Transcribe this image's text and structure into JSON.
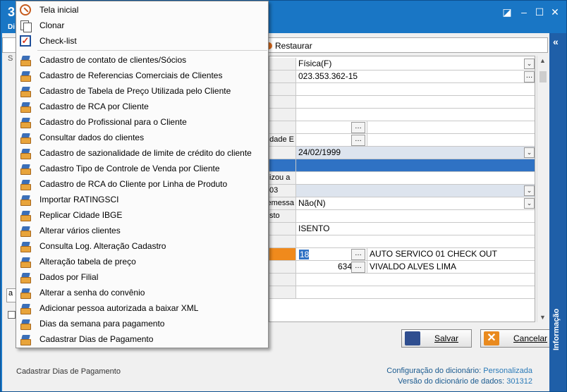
{
  "window": {
    "title_number": "3",
    "title_sub": "Di"
  },
  "toolbar": {
    "restore_label": "Restaurar"
  },
  "side_panel": {
    "label": "Informação"
  },
  "grid": {
    "rows": [
      {
        "label": "",
        "value": "Física(F)",
        "control": "dropdown"
      },
      {
        "label": "",
        "value": "023.353.362-15",
        "control": "ellipsis"
      },
      {
        "label": "",
        "value": "",
        "control": ""
      },
      {
        "label": "",
        "value": "",
        "control": ""
      },
      {
        "label": "",
        "value": "",
        "control": ""
      },
      {
        "label": "",
        "value": "",
        "control": "ellipsis-mid"
      },
      {
        "label": "idade E",
        "value": "",
        "control": "ellipsis-mid"
      },
      {
        "label": "",
        "value": "24/02/1999",
        "control": "dropdown"
      },
      {
        "label": "",
        "value": "",
        "control": "selected"
      },
      {
        "label": "izou a",
        "value": "",
        "control": ""
      },
      {
        "label": "03",
        "value": "",
        "control": "dropdown"
      },
      {
        "label": "emessa",
        "value": "Não(N)",
        "control": "dropdown"
      },
      {
        "label": "sto",
        "value": "",
        "control": ""
      },
      {
        "label": "",
        "value": "ISENTO",
        "control": ""
      },
      {
        "label": "",
        "value": "",
        "control": ""
      },
      {
        "label": "",
        "value": "18",
        "control": "rca",
        "extra": "AUTO SERVICO 01 CHECK OUT"
      },
      {
        "label": "",
        "value": "634",
        "control": "rca2",
        "extra": "VIVALDO ALVES LIMA"
      },
      {
        "label": "",
        "value": "",
        "control": ""
      },
      {
        "label": "",
        "value": "",
        "control": ""
      }
    ]
  },
  "buttons": {
    "save": "Salvar",
    "cancel": "Cancelar"
  },
  "footer": {
    "status": "Cadastrar Dias de Pagamento",
    "config_label": "Configuração do dicionário:",
    "config_value": "Personalizada",
    "version_label": "Versão do dicionário de dados:",
    "version_value": "301312"
  },
  "left_fragments": {
    "a": "S",
    "b": "a"
  },
  "menu": {
    "top_items": [
      {
        "label": "Tela inicial",
        "icon": "home-icon"
      },
      {
        "label": "Clonar",
        "icon": "clone-icon"
      },
      {
        "label": "Check-list",
        "icon": "checklist-icon"
      }
    ],
    "items": [
      "Cadastro de contato de clientes/Sócios",
      "Cadastro de Referencias Comerciais de Clientes",
      "Cadastro de Tabela de Preço Utilizada pelo Cliente",
      "Cadastro de RCA por Cliente",
      "Cadastro do Profissional para o Cliente",
      "Consultar dados do clientes",
      "Cadastro de sazionalidade de limite de crédito do cliente",
      "Cadastro Tipo de Controle de Venda por Cliente",
      "Cadastro de RCA do Cliente por Linha de Produto",
      "Importar RATINGSCI",
      "Replicar Cidade IBGE",
      "Alterar vários clientes",
      "Consulta Log. Alteração Cadastro",
      "Alteração tabela de preço",
      "Dados por Filial",
      "Alterar a senha do convênio",
      "Adicionar pessoa autorizada a baixar XML",
      "Dias da semana para pagamento",
      "Cadastrar Dias de Pagamento"
    ]
  }
}
